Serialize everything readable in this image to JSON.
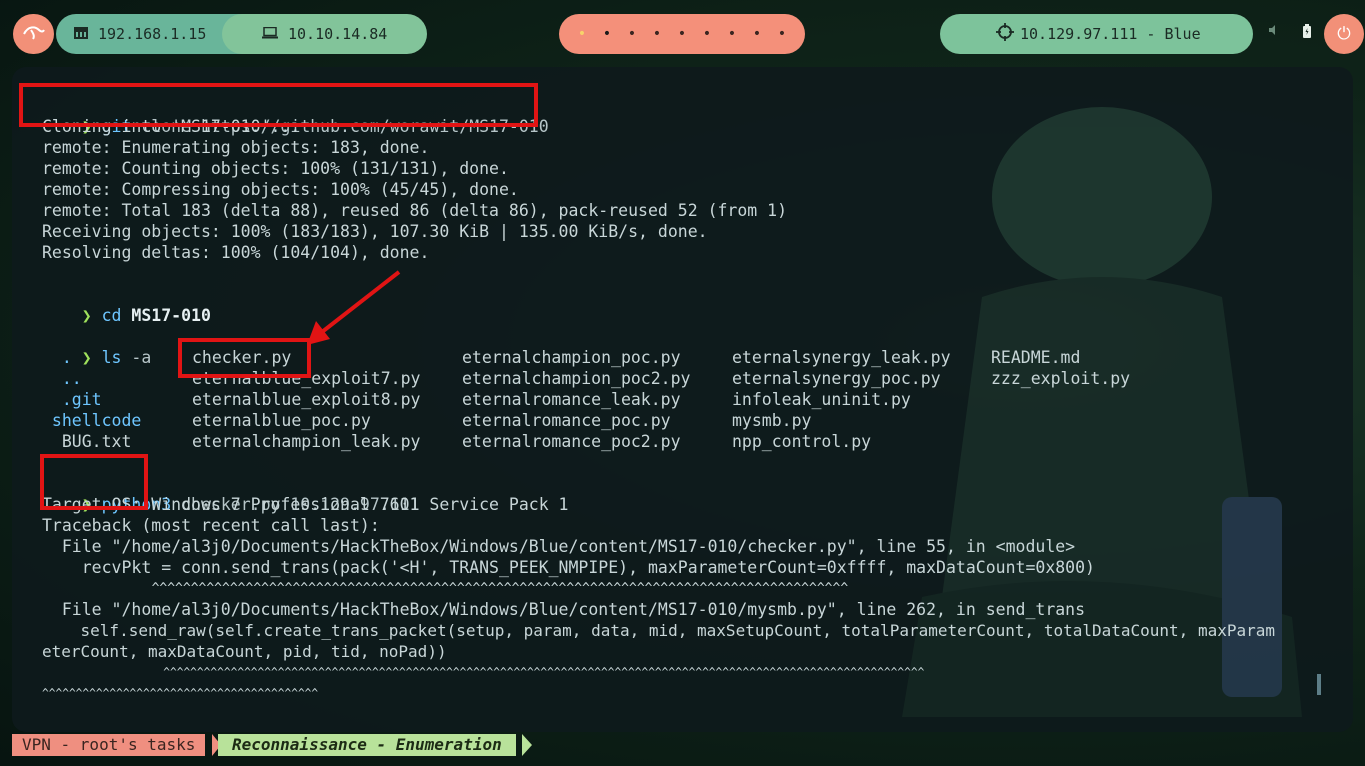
{
  "topbar": {
    "logo_icon": "kali-dragon-icon",
    "lan_ip": "192.168.1.15",
    "vpn_ip": "10.10.14.84",
    "workspaces": [
      "•",
      "•",
      "•",
      "•",
      "•",
      "•",
      "•",
      "•",
      "•"
    ],
    "target": "10.129.97.111 - Blue",
    "power_icon": "⏻"
  },
  "terminal": {
    "prompt_symbol": "❯",
    "cmd1": {
      "cmd": "git",
      "args": " clone https://github.com/worawit/MS17-010"
    },
    "output1": [
      "Cloning into 'MS17-010'...",
      "remote: Enumerating objects: 183, done.",
      "remote: Counting objects: 100% (131/131), done.",
      "remote: Compressing objects: 100% (45/45), done.",
      "remote: Total 183 (delta 88), reused 86 (delta 86), pack-reused 52 (from 1)",
      "Receiving objects: 100% (183/183), 107.30 KiB | 135.00 KiB/s, done.",
      "Resolving deltas: 100% (104/104), done."
    ],
    "cmd2": {
      "cmd": "cd",
      "args": " MS17-010"
    },
    "cmd3": {
      "cmd": "ls",
      "args": " -a"
    },
    "ls_columns": [
      [
        "  .",
        "  ..",
        "  .git",
        " shellcode",
        "  BUG.txt"
      ],
      [
        "checker.py",
        "eternalblue_exploit7.py",
        "eternalblue_exploit8.py",
        "eternalblue_poc.py",
        "eternalchampion_leak.py"
      ],
      [
        "eternalchampion_poc.py",
        "eternalchampion_poc2.py",
        "eternalromance_leak.py",
        "eternalromance_poc.py",
        "eternalromance_poc2.py"
      ],
      [
        "eternalsynergy_leak.py",
        "eternalsynergy_poc.py",
        "infoleak_uninit.py",
        "mysmb.py",
        "npp_control.py"
      ],
      [
        "README.md",
        "zzz_exploit.py"
      ]
    ],
    "cmd4": {
      "cmd": "python3",
      "args": " checker.py 10.129.97.111"
    },
    "output4": [
      "Target OS: Windows 7 Professional 7601 Service Pack 1",
      "Traceback (most recent call last):",
      "  File \"/home/al3j0/Documents/HackTheBox/Windows/Blue/content/MS17-010/checker.py\", line 55, in <module>",
      "    recvPkt = conn.send_trans(pack('<H', TRANS_PEEK_NMPIPE), maxParameterCount=0xffff, maxDataCount=0x800)",
      "              ^^^^^^^^^^^^^^^^^^^^^^^^^^^^^^^^^^^^^^^^^^^^^^^^^^^^^^^^^^^^^^^^^^^^^^^^^^^^^^^^^^^^^^^^^",
      "",
      "  File \"/home/al3j0/Documents/HackTheBox/Windows/Blue/content/MS17-010/mysmb.py\", line 262, in send_trans",
      "    self.send_raw(self.create_trans_packet(setup, param, data, mid, maxSetupCount, totalParameterCount, totalDataCount, maxParam",
      "eterCount, maxDataCount, pid, tid, noPad))",
      "                  ^^^^^^^^^^^^^^^^^^^^^^^^^^^^^^^^^^^^^^^^^^^^^^^^^^^^^^^^^^^^^^^^^^^^^^^^^^^^^^^^^^^^^^^^^^^^^^^^^^^^^^^^^^^^^^^^^",
      "^^^^^^^^^^^^^^^^^^^^^^^^^^^^^^^^^^^^^^^^^"
    ]
  },
  "statusbar": {
    "session": "VPN - root's tasks",
    "window": "Reconnaissance - Enumeration"
  },
  "colors": {
    "accent_orange": "#f29078",
    "accent_green": "#7dc39b",
    "highlight_red": "#e11414"
  }
}
